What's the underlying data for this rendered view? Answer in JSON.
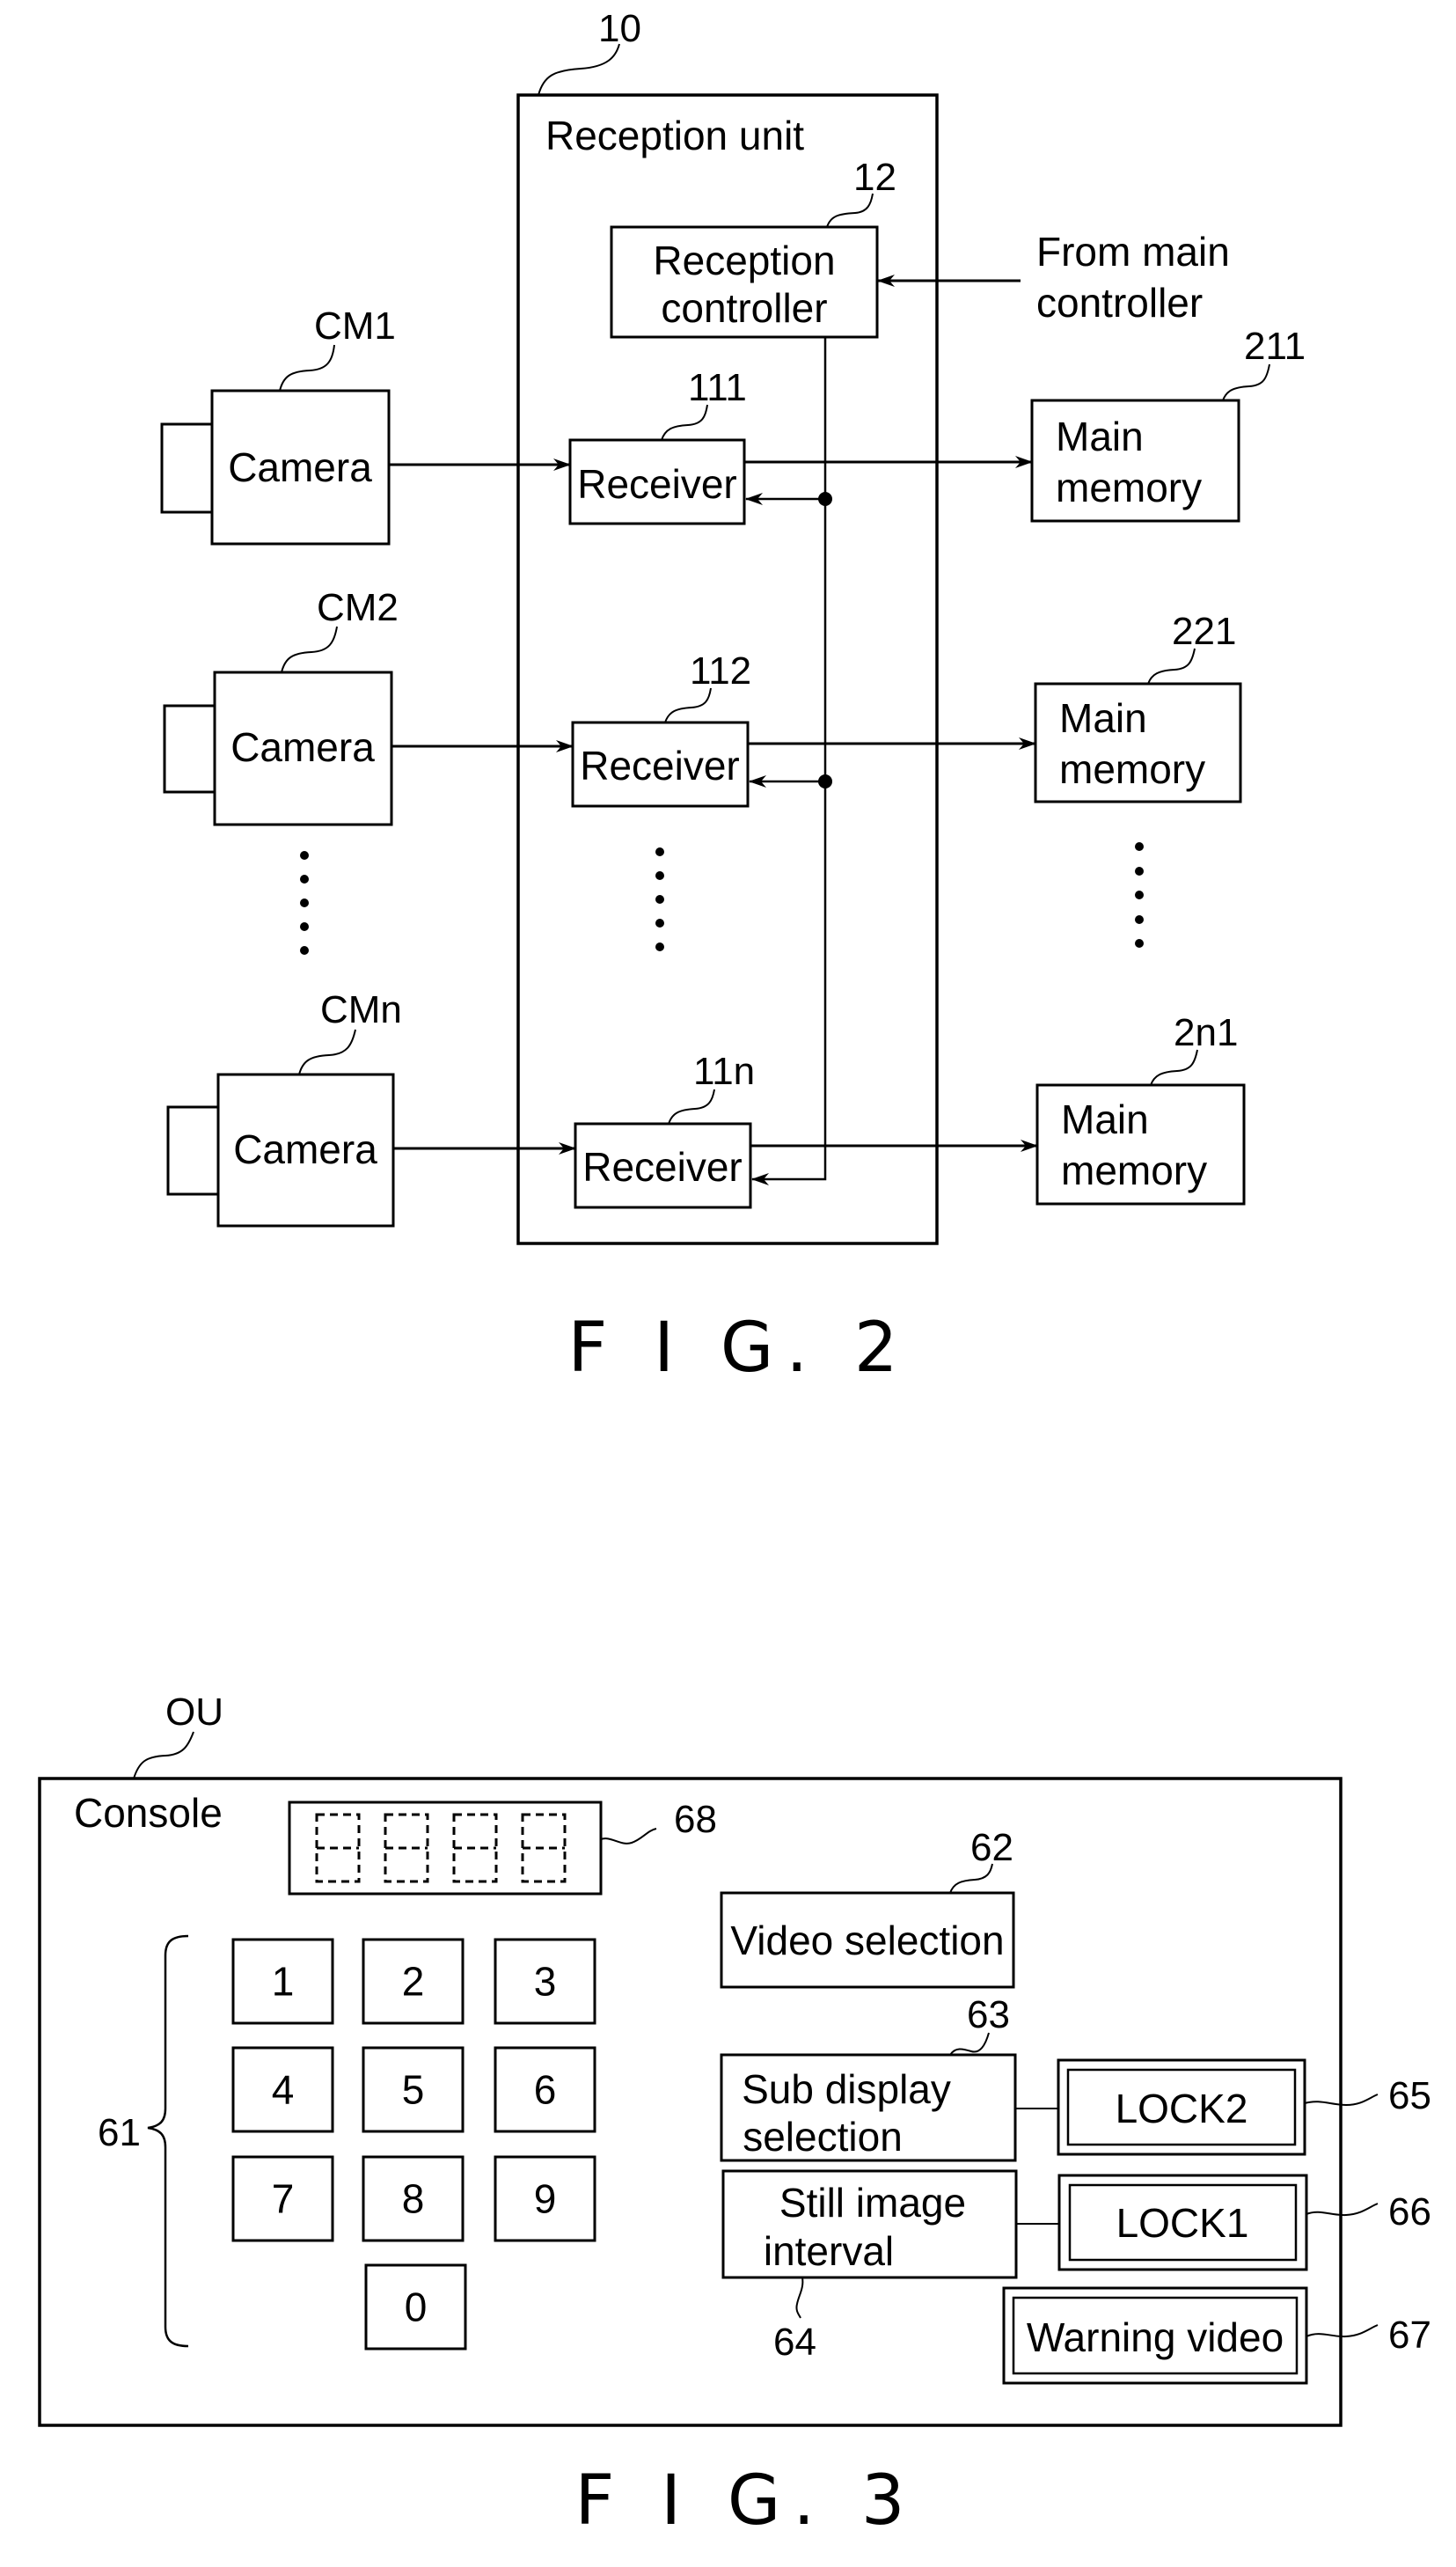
{
  "figure2": {
    "caption": "F I G. 2",
    "reception_unit": {
      "ref": "10",
      "label": "Reception unit"
    },
    "reception_controller": {
      "ref": "12",
      "line1": "Reception",
      "line2": "controller"
    },
    "external_input": {
      "line1": "From main",
      "line2": "controller"
    },
    "rows": [
      {
        "camera_ref": "CM1",
        "camera_label": "Camera",
        "receiver_ref": "111",
        "receiver_label": "Receiver",
        "memory_ref": "211",
        "memory_line1": "Main",
        "memory_line2": "memory"
      },
      {
        "camera_ref": "CM2",
        "camera_label": "Camera",
        "receiver_ref": "112",
        "receiver_label": "Receiver",
        "memory_ref": "221",
        "memory_line1": "Main",
        "memory_line2": "memory"
      },
      {
        "camera_ref": "CMn",
        "camera_label": "Camera",
        "receiver_ref": "11n",
        "receiver_label": "Receiver",
        "memory_ref": "2n1",
        "memory_line1": "Main",
        "memory_line2": "memory"
      }
    ]
  },
  "figure3": {
    "caption": "F I G. 3",
    "console": {
      "ref": "OU",
      "label": "Console"
    },
    "display": {
      "ref": "68",
      "digits": 4
    },
    "keypad": {
      "ref": "61",
      "keys": [
        "1",
        "2",
        "3",
        "4",
        "5",
        "6",
        "7",
        "8",
        "9",
        "0"
      ]
    },
    "video_selection": {
      "ref": "62",
      "label": "Video selection"
    },
    "sub_display_selection": {
      "ref": "63",
      "line1": "Sub display",
      "line2": "selection"
    },
    "still_image_interval": {
      "ref": "64",
      "line1": "Still image",
      "line2": "interval"
    },
    "lock2": {
      "ref": "65",
      "label": "LOCK2"
    },
    "lock1": {
      "ref": "66",
      "label": "LOCK1"
    },
    "warning_video": {
      "ref": "67",
      "label": "Warning video"
    }
  }
}
